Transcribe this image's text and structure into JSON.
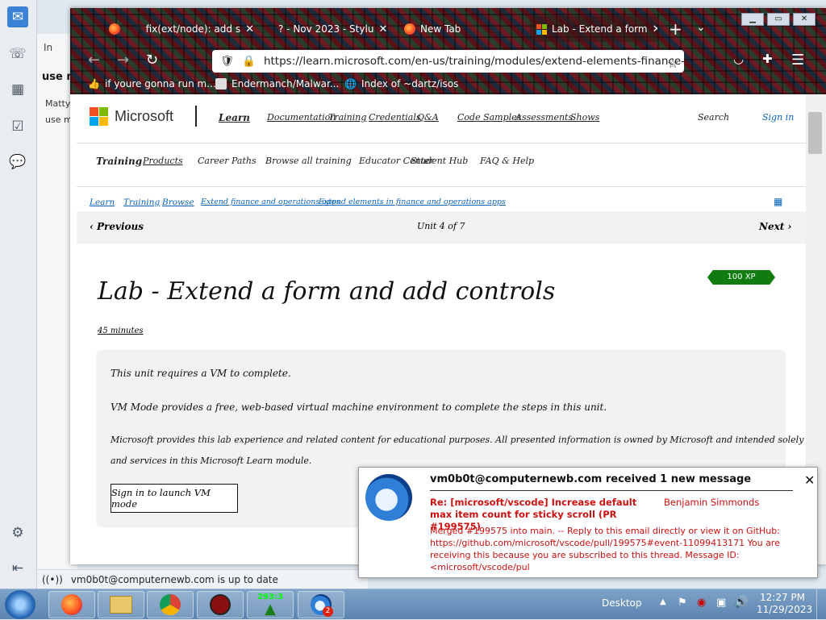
{
  "thunderbird": {
    "left_icons": [
      "mail-icon",
      "address-book-icon",
      "calendar-icon",
      "tasks-icon",
      "chat-icon",
      "settings-icon",
      "collapse-icon"
    ],
    "peek_texts": [
      "In",
      "use m",
      "Matty)",
      "use m"
    ],
    "status": "vm0b0t@computernewb.com is up to date"
  },
  "firefox": {
    "tabs": [
      {
        "label": "",
        "icon": "firefox-icon"
      },
      {
        "label": "fix(ext/node): add s",
        "icon": "github-icon"
      },
      {
        "label": "? - Nov 2023 - Stylu",
        "icon": "stylus-icon"
      },
      {
        "label": "New Tab",
        "icon": "firefox-icon"
      },
      {
        "label": "Lab - Extend a form",
        "icon": "microsoft-icon",
        "active": true
      }
    ],
    "url": "https://learn.microsoft.com/en-us/training/modules/extend-elements-finance-op",
    "bookmarks": [
      "if youre gonna run m...",
      "Endermanch/Malwar...",
      "Index of ~dartz/isos"
    ]
  },
  "page": {
    "brand": "Microsoft",
    "nav1": [
      "Learn",
      "Documentation",
      "Training",
      "Credentials",
      "Q&A",
      "Code Samples",
      "Assessments",
      "Shows"
    ],
    "search": "Search",
    "signin": "Sign in",
    "nav2": [
      "Training",
      "Products",
      "Career Paths",
      "Browse all training",
      "Educator Center",
      "Student Hub",
      "FAQ & Help"
    ],
    "breadcrumbs": [
      "Learn",
      "Training",
      "Browse",
      "Extend finance and operations apps",
      "Extend elements in finance and operations apps"
    ],
    "unitbar": {
      "previous": "Previous",
      "unit": "Unit 4 of 7",
      "next": "Next"
    },
    "badge": "100 XP",
    "title": "Lab - Extend a form and add controls",
    "duration": "45 minutes",
    "notes": [
      "This unit requires a VM to complete.",
      "VM Mode provides a free, web-based virtual machine environment to complete the steps in this unit.",
      "Microsoft provides this lab experience and related content for educational purposes. All presented information is owned by Microsoft and intended solely for learning about the covered products",
      "and services in this Microsoft Learn module."
    ],
    "vm_button": "Sign in to launch VM mode"
  },
  "notification": {
    "header": "vm0b0t@computernewb.com received 1 new message",
    "subject": "Re: [microsoft/vscode] Increase default max item count for sticky scroll (PR #199575)",
    "sender": "Benjamin Simmonds",
    "body": "Merged #199575 into main. -- Reply to this email directly or view it on GitHub: https://github.com/microsoft/vscode/pull/199575#event-11099413171 You are receiving this because you are subscribed to this thread. Message ID: <microsoft/vscode/pul"
  },
  "taskbar": {
    "desktop": "Desktop",
    "time": "12:27 PM",
    "date": "11/29/2023",
    "clock_badge": "293:3",
    "thunderbird_badge": "2"
  },
  "colors": {
    "notif_red": "#cc1111",
    "link_blue": "#0a63b8",
    "xp_green": "#107c10"
  }
}
